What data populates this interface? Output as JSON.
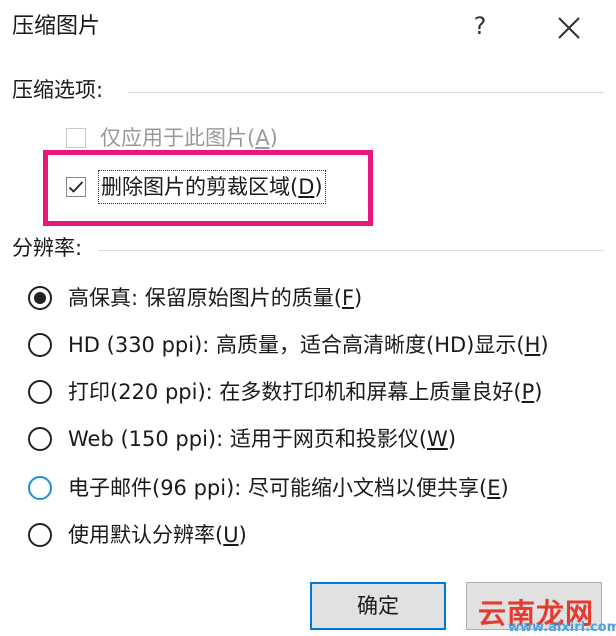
{
  "dialog": {
    "title": "压缩图片",
    "help_label": "?",
    "close_icon": "close-icon"
  },
  "compress_options": {
    "group_label": "压缩选项:",
    "apply_only_label": "仅应用于此图片(",
    "apply_only_key": "A",
    "apply_only_close": ")",
    "apply_only_checked": false,
    "apply_only_enabled": false,
    "delete_crop_label": "删除图片的剪裁区域(",
    "delete_crop_key": "D",
    "delete_crop_close": ")",
    "delete_crop_checked": true
  },
  "resolution": {
    "group_label": "分辨率:",
    "options": [
      {
        "pre": "高保真: 保留原始图片的质量(",
        "key": "F",
        "post": ")",
        "selected": true
      },
      {
        "pre": "HD (330 ppi): 高质量，适合高清晰度(HD)显示(",
        "key": "H",
        "post": ")",
        "selected": false
      },
      {
        "pre": "打印(220 ppi): 在多数打印机和屏幕上质量良好(",
        "key": "P",
        "post": ")",
        "selected": false
      },
      {
        "pre": "Web (150 ppi): 适用于网页和投影仪(",
        "key": "W",
        "post": ")",
        "selected": false
      },
      {
        "pre": "电子邮件(96 ppi): 尽可能缩小文档以便共享(",
        "key": "E",
        "post": ")",
        "selected": false
      },
      {
        "pre": "使用默认分辨率(",
        "key": "U",
        "post": ")",
        "selected": false
      }
    ]
  },
  "buttons": {
    "ok": "确定"
  },
  "watermark": {
    "main": "云南龙网",
    "sub": "www.aixiri.com"
  },
  "colors": {
    "highlight": "#e6177c",
    "focus_blue": "#0078d7"
  }
}
